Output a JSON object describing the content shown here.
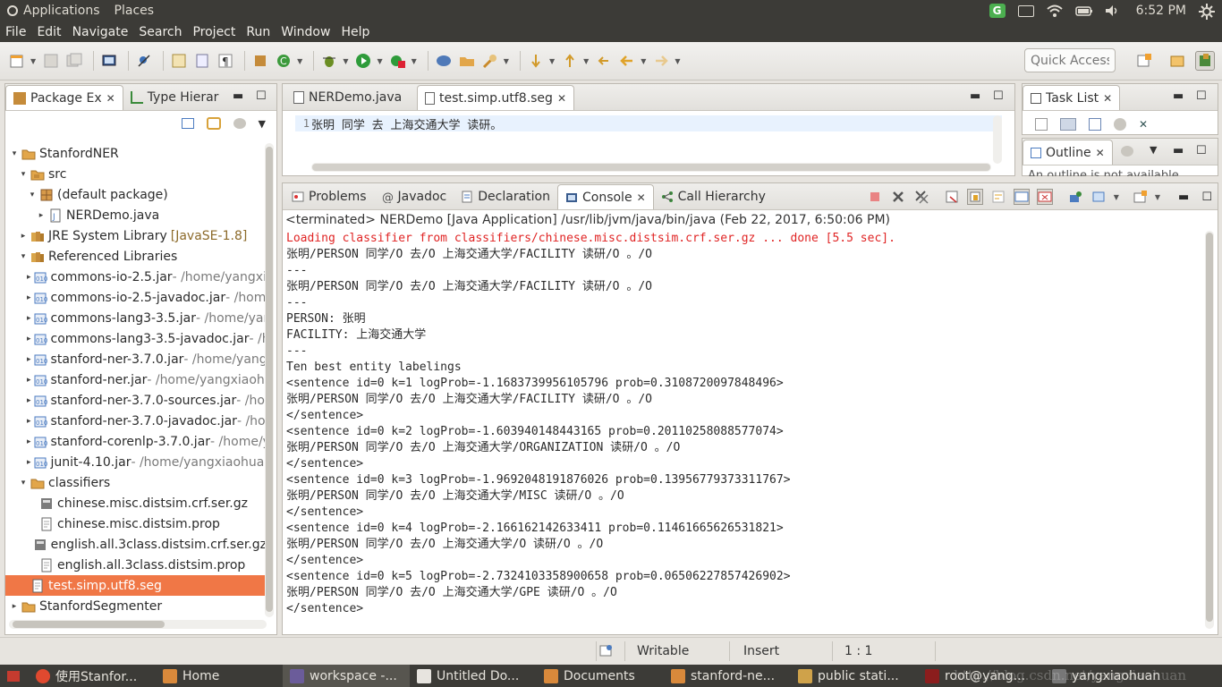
{
  "system_panel": {
    "apps_menu": "Applications",
    "places_menu": "Places",
    "clock": "6:52 PM"
  },
  "menubar": [
    "File",
    "Edit",
    "Navigate",
    "Search",
    "Project",
    "Run",
    "Window",
    "Help"
  ],
  "toolbar": {
    "quick_access_placeholder": "Quick Access"
  },
  "package_explorer": {
    "tabs": [
      {
        "label": "Package Ex",
        "active": true
      },
      {
        "label": "Type Hierar",
        "active": false
      }
    ],
    "tree": [
      {
        "indent": 0,
        "arrow": "▾",
        "icon": "project-icon",
        "label": "StanfordNER",
        "dim": ""
      },
      {
        "indent": 1,
        "arrow": "▾",
        "icon": "source-folder-icon",
        "label": "src",
        "dim": ""
      },
      {
        "indent": 2,
        "arrow": "▾",
        "icon": "package-icon",
        "label": "(default package)",
        "dim": ""
      },
      {
        "indent": 3,
        "arrow": "▸",
        "icon": "java-file-icon",
        "label": "NERDemo.java",
        "dim": ""
      },
      {
        "indent": 1,
        "arrow": "▸",
        "icon": "library-icon",
        "label": "JRE System Library",
        "jse": "[JavaSE-1.8]",
        "dim": ""
      },
      {
        "indent": 1,
        "arrow": "▾",
        "icon": "library-icon",
        "label": "Referenced Libraries",
        "dim": ""
      },
      {
        "indent": 2,
        "arrow": "▸",
        "icon": "jar-icon",
        "label": "commons-io-2.5.jar",
        "dim": " - /home/yangxia"
      },
      {
        "indent": 2,
        "arrow": "▸",
        "icon": "jar-icon",
        "label": "commons-io-2.5-javadoc.jar",
        "dim": " - /home/"
      },
      {
        "indent": 2,
        "arrow": "▸",
        "icon": "jar-icon",
        "label": "commons-lang3-3.5.jar",
        "dim": " - /home/yang"
      },
      {
        "indent": 2,
        "arrow": "▸",
        "icon": "jar-icon",
        "label": "commons-lang3-3.5-javadoc.jar",
        "dim": " - /ho"
      },
      {
        "indent": 2,
        "arrow": "▸",
        "icon": "jar-icon",
        "label": "stanford-ner-3.7.0.jar",
        "dim": " - /home/yangx"
      },
      {
        "indent": 2,
        "arrow": "▸",
        "icon": "jar-icon",
        "label": "stanford-ner.jar",
        "dim": " - /home/yangxiaohu"
      },
      {
        "indent": 2,
        "arrow": "▸",
        "icon": "jar-icon",
        "label": "stanford-ner-3.7.0-sources.jar",
        "dim": " - /hom"
      },
      {
        "indent": 2,
        "arrow": "▸",
        "icon": "jar-icon",
        "label": "stanford-ner-3.7.0-javadoc.jar",
        "dim": " - /hom"
      },
      {
        "indent": 2,
        "arrow": "▸",
        "icon": "jar-icon",
        "label": "stanford-corenlp-3.7.0.jar",
        "dim": " - /home/y"
      },
      {
        "indent": 2,
        "arrow": "▸",
        "icon": "jar-icon",
        "label": "junit-4.10.jar",
        "dim": " - /home/yangxiaohuan/"
      },
      {
        "indent": 1,
        "arrow": "▾",
        "icon": "folder-icon",
        "label": "classifiers",
        "dim": ""
      },
      {
        "indent": 2,
        "arrow": "",
        "icon": "archive-file-icon",
        "label": "chinese.misc.distsim.crf.ser.gz",
        "dim": ""
      },
      {
        "indent": 2,
        "arrow": "",
        "icon": "text-file-icon",
        "label": "chinese.misc.distsim.prop",
        "dim": ""
      },
      {
        "indent": 2,
        "arrow": "",
        "icon": "archive-file-icon",
        "label": "english.all.3class.distsim.crf.ser.gz",
        "dim": ""
      },
      {
        "indent": 2,
        "arrow": "",
        "icon": "text-file-icon",
        "label": "english.all.3class.distsim.prop",
        "dim": ""
      },
      {
        "indent": 1,
        "arrow": "",
        "icon": "text-file-icon",
        "label": "test.simp.utf8.seg",
        "dim": "",
        "selected": true
      },
      {
        "indent": 0,
        "arrow": "▸",
        "icon": "project-icon",
        "label": "StanfordSegmenter",
        "dim": ""
      }
    ]
  },
  "editor": {
    "tabs": [
      {
        "label": "NERDemo.java",
        "active": false
      },
      {
        "label": "test.simp.utf8.seg",
        "active": true
      }
    ],
    "line_number": "1",
    "line_text": "张明 同学 去 上海交通大学 读研。"
  },
  "task_list": {
    "label": "Task List"
  },
  "outline": {
    "label": "Outline",
    "message": "An outline is not available."
  },
  "console": {
    "tabs": [
      {
        "label": "Problems",
        "active": false,
        "icon": "problems-icon"
      },
      {
        "label": "Javadoc",
        "active": false,
        "icon": "javadoc-icon"
      },
      {
        "label": "Declaration",
        "active": false,
        "icon": "declaration-icon"
      },
      {
        "label": "Console",
        "active": true,
        "icon": "console-icon"
      },
      {
        "label": "Call Hierarchy",
        "active": false,
        "icon": "call-hierarchy-icon"
      }
    ],
    "header": "<terminated> NERDemo [Java Application] /usr/lib/jvm/java/bin/java (Feb 22, 2017, 6:50:06 PM)",
    "lines": [
      {
        "text": "Loading classifier from classifiers/chinese.misc.distsim.crf.ser.gz ... done [5.5 sec].",
        "err": true
      },
      {
        "text": "张明/PERSON 同学/O 去/O 上海交通大学/FACILITY 读研/O 。/O",
        "err": false
      },
      {
        "text": "---",
        "err": false
      },
      {
        "text": "张明/PERSON 同学/O 去/O 上海交通大学/FACILITY 读研/O 。/O",
        "err": false
      },
      {
        "text": "---",
        "err": false
      },
      {
        "text": "PERSON: 张明",
        "err": false
      },
      {
        "text": "FACILITY: 上海交通大学",
        "err": false
      },
      {
        "text": "---",
        "err": false
      },
      {
        "text": "Ten best entity labelings",
        "err": false
      },
      {
        "text": "<sentence id=0 k=1 logProb=-1.1683739956105796 prob=0.3108720097848496>",
        "err": false
      },
      {
        "text": "张明/PERSON 同学/O 去/O 上海交通大学/FACILITY 读研/O 。/O",
        "err": false
      },
      {
        "text": "</sentence>",
        "err": false
      },
      {
        "text": "<sentence id=0 k=2 logProb=-1.603940148443165 prob=0.20110258088577074>",
        "err": false
      },
      {
        "text": "张明/PERSON 同学/O 去/O 上海交通大学/ORGANIZATION 读研/O 。/O",
        "err": false
      },
      {
        "text": "</sentence>",
        "err": false
      },
      {
        "text": "<sentence id=0 k=3 logProb=-1.9692048191876026 prob=0.13956779373311767>",
        "err": false
      },
      {
        "text": "张明/PERSON 同学/O 去/O 上海交通大学/MISC 读研/O 。/O",
        "err": false
      },
      {
        "text": "</sentence>",
        "err": false
      },
      {
        "text": "<sentence id=0 k=4 logProb=-2.166162142633411 prob=0.11461665626531821>",
        "err": false
      },
      {
        "text": "张明/PERSON 同学/O 去/O 上海交通大学/O 读研/O 。/O",
        "err": false
      },
      {
        "text": "</sentence>",
        "err": false
      },
      {
        "text": "<sentence id=0 k=5 logProb=-2.7324103358900658 prob=0.06506227857426902>",
        "err": false
      },
      {
        "text": "张明/PERSON 同学/O 去/O 上海交通大学/GPE 读研/O 。/O",
        "err": false
      },
      {
        "text": "</sentence>",
        "err": false
      }
    ]
  },
  "statusbar": {
    "writable": "Writable",
    "insert_mode": "Insert",
    "position": "1 : 1"
  },
  "taskbar": {
    "items": [
      {
        "label": "使用Stanfor...",
        "icon": "chrome-icon",
        "color": "#e0492f",
        "active": false
      },
      {
        "label": "Home",
        "icon": "folder-icon",
        "color": "#d9893b",
        "active": false
      },
      {
        "label": "workspace -...",
        "icon": "eclipse-icon",
        "color": "#6b5c9a",
        "active": true
      },
      {
        "label": "Untitled Do...",
        "icon": "document-icon",
        "color": "#e7e4df",
        "active": false
      },
      {
        "label": "Documents",
        "icon": "folder-icon",
        "color": "#d9893b",
        "active": false
      },
      {
        "label": "stanford-ne...",
        "icon": "folder-icon",
        "color": "#d9893b",
        "active": false
      },
      {
        "label": "public stati...",
        "icon": "image-viewer-icon",
        "color": "#cfa24a",
        "active": false
      },
      {
        "label": "root@yang...",
        "icon": "terminal-icon",
        "color": "#8b1d1d",
        "active": false
      },
      {
        "label": "yangxiaohuan",
        "icon": "user-icon",
        "color": "#777",
        "active": false
      }
    ]
  },
  "watermark": "http://blog.csdn.net/yangxiaohuan"
}
